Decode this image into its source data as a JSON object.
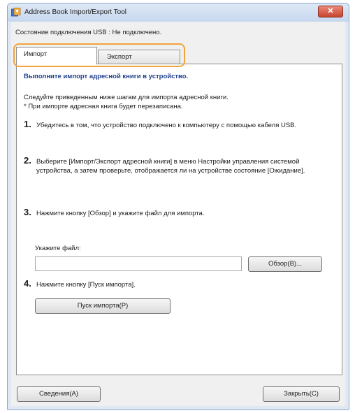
{
  "window": {
    "title": "Address Book Import/Export Tool",
    "close_glyph": "✕"
  },
  "status_text": "Состояние подключения USB : Не подключено.",
  "tabs": [
    {
      "label": "Импорт",
      "selected": true
    },
    {
      "label": "Экспорт",
      "selected": false
    }
  ],
  "panel": {
    "heading": "Выполните импорт адресной книги в устройство.",
    "intro_line1": "Следуйте приведенным ниже шагам для импорта адресной книги.",
    "intro_line2": "* При импорте адресная книга будет перезаписана.",
    "steps": [
      {
        "num": "1.",
        "text": "Убедитесь в том, что устройство подключено к компьютеру с помощью кабеля USB."
      },
      {
        "num": "2.",
        "text": "Выберите [Импорт/Экспорт адресной книги] в меню Настройки управления системой устройства, а затем проверьте, отображается ли на устройстве состояние [Ожидание]."
      },
      {
        "num": "3.",
        "text": "Нажмите кнопку [Обзор] и укажите файл для импорта."
      },
      {
        "num": "4.",
        "text": "Нажмите кнопку [Пуск импорта]."
      }
    ],
    "file_label": "Укажите файл:",
    "file_value": "",
    "browse_label": "Обзор(B)...",
    "start_label": "Пуск импорта(P)"
  },
  "footer": {
    "info_label": "Сведения(A)",
    "close_label": "Закрыть(C)"
  },
  "colors": {
    "heading": "#1f3f8c",
    "highlight": "#f2a33c",
    "close_button": "#c6452f"
  }
}
